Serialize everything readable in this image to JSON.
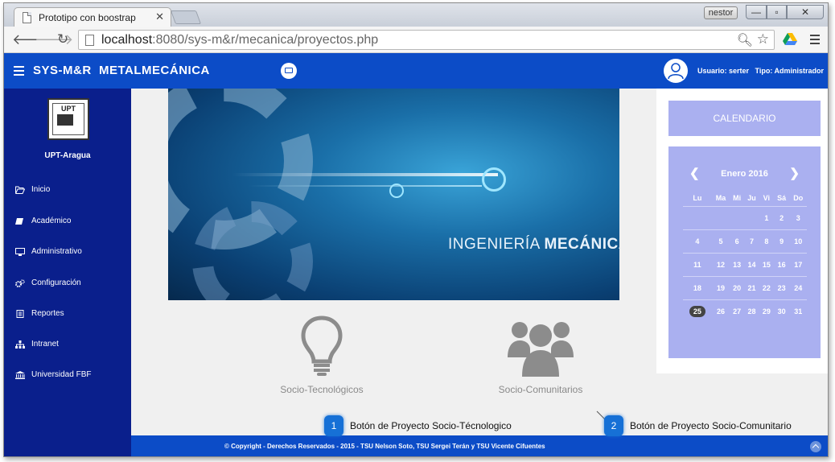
{
  "browser": {
    "tab_title": "Prototipo con boostrap",
    "tab_close": "✕",
    "user_chip": "nestor",
    "url_prefix": "localhost",
    "url": ":8080/sys-m&r/mecanica/proyectos.php",
    "win_min": "—",
    "win_max": "▫",
    "win_close": "✕"
  },
  "app": {
    "brand": "SYS-M&R  METALMECÁNICA",
    "user_label": "Usuario: serter",
    "role_label": "Tipo: Administrador",
    "icons": {
      "menu": "hamburger-icon",
      "mail": "envelope-icon",
      "user": "user-avatar-icon"
    }
  },
  "sidebar": {
    "org_name": "UPT-Aragua",
    "logo_text": "UPT",
    "items": [
      {
        "label": "Inicio",
        "icon": "folder-open-icon"
      },
      {
        "label": "Académico",
        "icon": "book-icon"
      },
      {
        "label": "Administrativo",
        "icon": "desktop-icon"
      },
      {
        "label": "Configuración",
        "icon": "cogs-icon"
      },
      {
        "label": "Reportes",
        "icon": "file-text-icon"
      },
      {
        "label": "Intranet",
        "icon": "sitemap-icon"
      },
      {
        "label": "Universidad FBF",
        "icon": "university-icon"
      }
    ]
  },
  "banner": {
    "caption_light": "INGENIERÍA ",
    "caption_bold": "MECÁNICA"
  },
  "projects": [
    {
      "label": "Socio-Tecnológicos",
      "icon": "lightbulb-icon"
    },
    {
      "label": "Socio-Comunitarios",
      "icon": "users-icon"
    }
  ],
  "callouts": [
    {
      "number": "1",
      "text": "Botón de Proyecto Socio-Técnologico"
    },
    {
      "number": "2",
      "text": "Botón de Proyecto Socio-Comunitario"
    }
  ],
  "calendar": {
    "heading": "CALENDARIO",
    "month": "Enero 2016",
    "prev": "❮",
    "next": "❯",
    "weekdays": [
      "Lu",
      "Ma",
      "Mi",
      "Ju",
      "Vi",
      "Sá",
      "Do"
    ],
    "weeks": [
      [
        "",
        "",
        "",
        "",
        "1",
        "2",
        "3"
      ],
      [
        "4",
        "5",
        "6",
        "7",
        "8",
        "9",
        "10"
      ],
      [
        "11",
        "12",
        "13",
        "14",
        "15",
        "16",
        "17"
      ],
      [
        "18",
        "19",
        "20",
        "21",
        "22",
        "23",
        "24"
      ],
      [
        "25",
        "26",
        "27",
        "28",
        "29",
        "30",
        "31"
      ]
    ],
    "today": "25"
  },
  "footer": {
    "text": "© Copyright - Derechos Reservados - 2015 - TSU Nelson Soto, TSU Sergei Terán y TSU Vicente Cifuentes"
  }
}
